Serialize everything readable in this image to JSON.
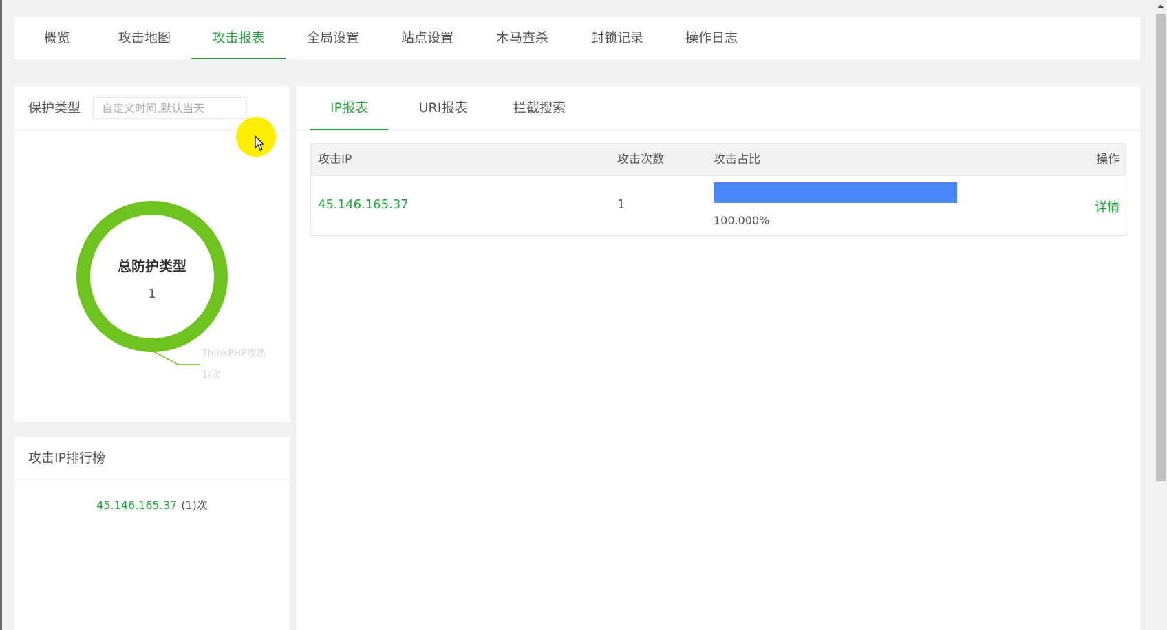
{
  "topnav": {
    "tabs": [
      {
        "label": "概览"
      },
      {
        "label": "攻击地图"
      },
      {
        "label": "攻击报表"
      },
      {
        "label": "全局设置"
      },
      {
        "label": "站点设置"
      },
      {
        "label": "木马查杀"
      },
      {
        "label": "封锁记录"
      },
      {
        "label": "操作日志"
      }
    ],
    "active": "攻击报表"
  },
  "protection": {
    "title": "保护类型",
    "time_placeholder": "自定义时间,默认当天",
    "donut_title": "总防护类型",
    "donut_total": "1",
    "donut_color": "#6fc31e",
    "slice_label": "ThinkPHP攻击",
    "slice_value": "1/次"
  },
  "ranking": {
    "title": "攻击IP排行榜",
    "items": [
      {
        "ip": "45.146.165.37",
        "count": "(1)次"
      }
    ]
  },
  "report": {
    "tabs": [
      {
        "label": "IP报表"
      },
      {
        "label": "URI报表"
      },
      {
        "label": "拦截搜索"
      }
    ],
    "active": "IP报表",
    "columns": [
      "攻击IP",
      "攻击次数",
      "攻击占比",
      "操作"
    ],
    "rows": [
      {
        "ip": "45.146.165.37",
        "count": "1",
        "share": 1.0,
        "share_label": "100.000%",
        "action": "详情"
      }
    ],
    "bar_color": "#4a86ff"
  },
  "colors": {
    "accent": "#20a53a"
  }
}
